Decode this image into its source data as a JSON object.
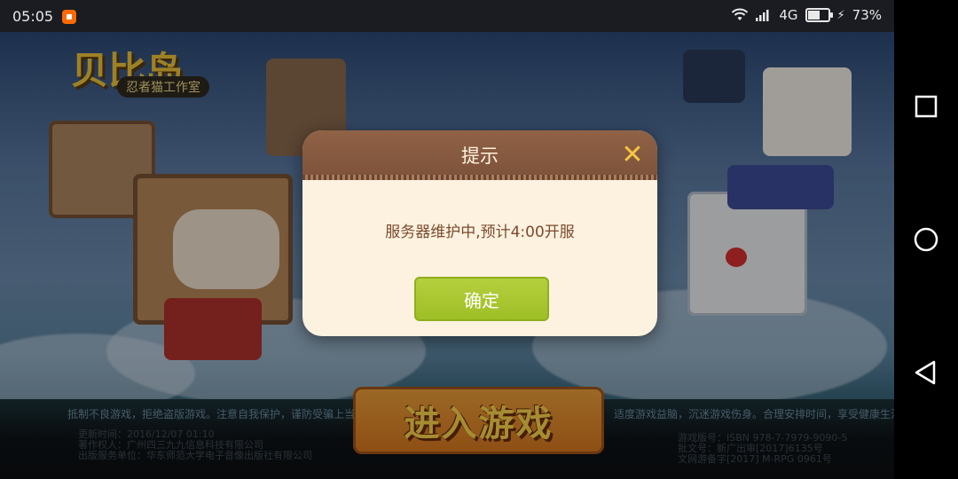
{
  "status_bar": {
    "time": "05:05",
    "network": "4G",
    "battery": "73%",
    "battery_level": 0.73
  },
  "game": {
    "logo_title": "贝比岛",
    "logo_subtitle": "忍者猫工作室",
    "enter_button": "进入游戏",
    "tagline_left": "抵制不良游戏，拒绝盗版游戏。注意自我保护，谨防受骗上当",
    "tagline_right": "适度游戏益脑，沉迷游戏伤身。合理安排时间，享受健康生活",
    "info_left": {
      "line1": "更新时间：2016/12/07 01:10",
      "line2": "著作权人：广州四三九九信息科技有限公司",
      "line3": "出版服务单位：华东师范大学电子音像出版社有限公司"
    },
    "info_right": {
      "line1": "游戏版号：ISBN 978-7-7979-9090-5",
      "line2": "批文号：新广出审[2017]6135号",
      "line3": "文网游备字[2017] M-RPG 0961号"
    }
  },
  "dialog": {
    "title": "提示",
    "message": "服务器维护中,预计4:00开服",
    "confirm_label": "确定",
    "close_icon": "close-icon"
  },
  "colors": {
    "dialog_header": "#8b5e43",
    "dialog_body": "#fcf2df",
    "confirm_button": "#a8c92e",
    "close_icon": "#f5c542",
    "message_text": "#7b4b2e"
  },
  "nav_bar": {
    "icons": [
      "recent-apps-icon",
      "home-icon",
      "back-icon"
    ]
  }
}
